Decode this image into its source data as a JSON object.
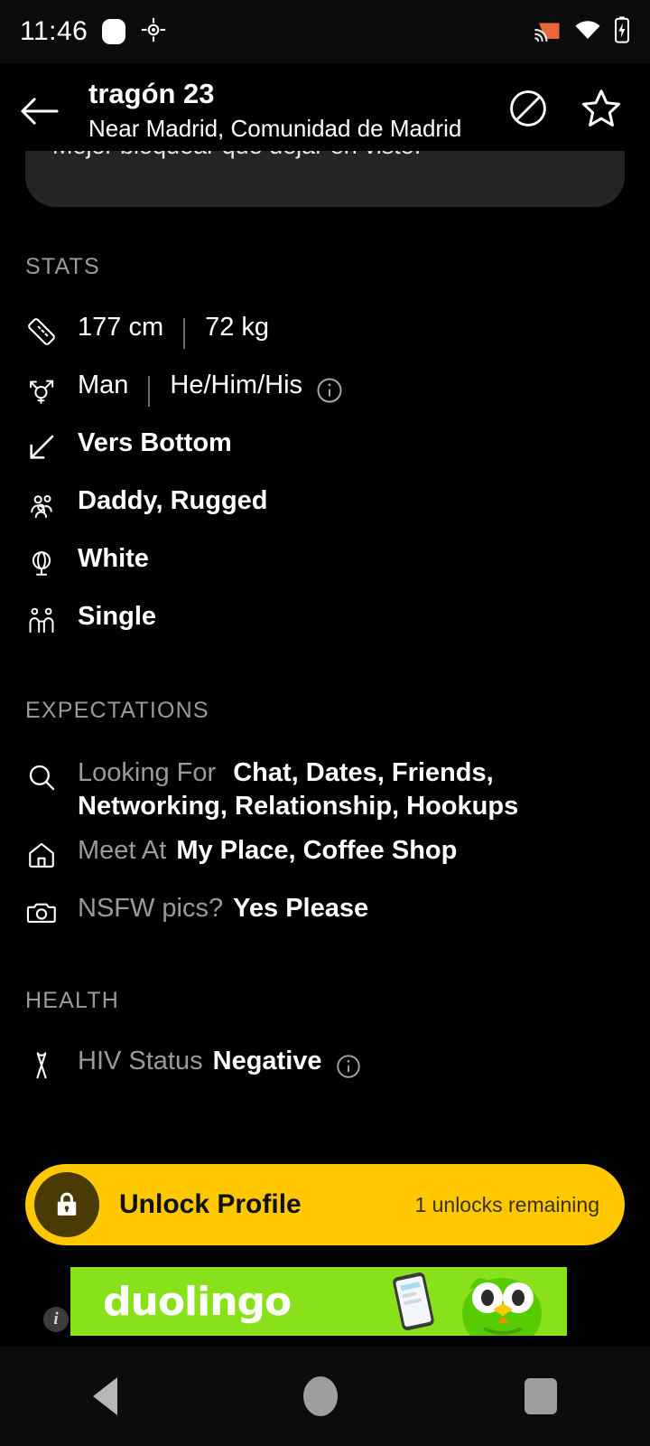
{
  "statusbar": {
    "time": "11:46",
    "icons": [
      "notification-dot",
      "location-crosshair-icon",
      "cast-icon",
      "wifi-icon",
      "battery-charging-icon"
    ]
  },
  "header": {
    "back_icon": "back-arrow-icon",
    "name": "tragón 23",
    "location": "Near Madrid, Comunidad de Madrid",
    "block_icon": "block-icon",
    "favorite_icon": "star-icon"
  },
  "message_bubble": {
    "text": "Mejor bloquear que dejar en visto."
  },
  "stats": {
    "label": "STATS",
    "height": "177 cm",
    "weight": "72 kg",
    "gender": "Man",
    "pronouns": "He/Him/His",
    "position": "Vers Bottom",
    "tribes": "Daddy, Rugged",
    "ethnicity": "White",
    "relationship": "Single",
    "icons": {
      "measure": "ruler-icon",
      "gender": "transgender-icon",
      "position": "diagonal-arrow-icon",
      "tribes": "people-group-icon",
      "ethnicity": "globe-icon",
      "relationship": "two-people-icon",
      "info": "info-icon"
    }
  },
  "expectations": {
    "label": "EXPECTATIONS",
    "looking_for_label": "Looking For",
    "looking_for_value": "Chat, Dates, Friends, Networking, Relationship, Hookups",
    "meet_at_label": "Meet At",
    "meet_at_value": "My Place, Coffee Shop",
    "nsfw_label": "NSFW pics?",
    "nsfw_value": "Yes Please",
    "icons": {
      "looking_for": "search-icon",
      "meet_at": "home-icon",
      "nsfw": "camera-icon"
    }
  },
  "health": {
    "label": "HEALTH",
    "hiv_label": "HIV Status",
    "hiv_value": "Negative",
    "icons": {
      "hiv": "ribbon-icon",
      "info": "info-icon"
    }
  },
  "unlock": {
    "label": "Unlock Profile",
    "remaining": "1 unlocks remaining",
    "lock_icon": "lock-icon",
    "accent_color": "#ffc800"
  },
  "ad": {
    "brand": "duolingo",
    "background_color": "#89e219",
    "info_badge": "i",
    "art_icons": [
      "phone-icon",
      "owl-mascot-icon"
    ]
  },
  "navbar": {
    "back": "nav-back-icon",
    "home": "nav-home-icon",
    "recents": "nav-recents-icon"
  }
}
